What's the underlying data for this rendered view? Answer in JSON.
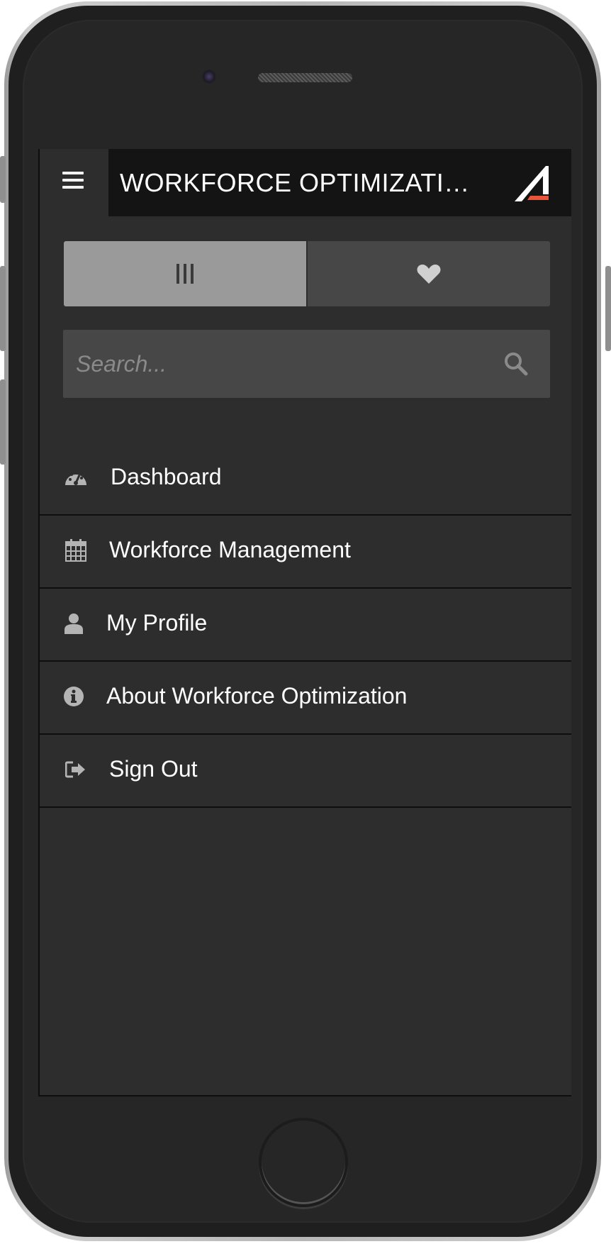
{
  "header": {
    "title": "WORKFORCE OPTIMIZATI…",
    "menu_icon": "hamburger-icon",
    "logo": "app-logo"
  },
  "toggle": {
    "items": [
      {
        "icon": "columns-icon",
        "glyph": "III",
        "active": true
      },
      {
        "icon": "heart-icon",
        "glyph": "♥",
        "active": false
      }
    ]
  },
  "search": {
    "placeholder": "Search...",
    "value": "",
    "icon": "search-icon"
  },
  "menu": {
    "items": [
      {
        "label": "Dashboard",
        "icon": "dashboard-icon"
      },
      {
        "label": "Workforce Management",
        "icon": "calendar-icon"
      },
      {
        "label": "My Profile",
        "icon": "user-icon"
      },
      {
        "label": "About Workforce Optimization",
        "icon": "info-icon"
      },
      {
        "label": "Sign Out",
        "icon": "sign-out-icon"
      }
    ]
  },
  "colors": {
    "screen_bg": "#2d2d2d",
    "header_bg": "#141414",
    "toggle_active": "#9a9a9a",
    "toggle_inactive": "#474747",
    "icon_gray": "#b4b4b4",
    "logo_accent": "#e8553a"
  }
}
